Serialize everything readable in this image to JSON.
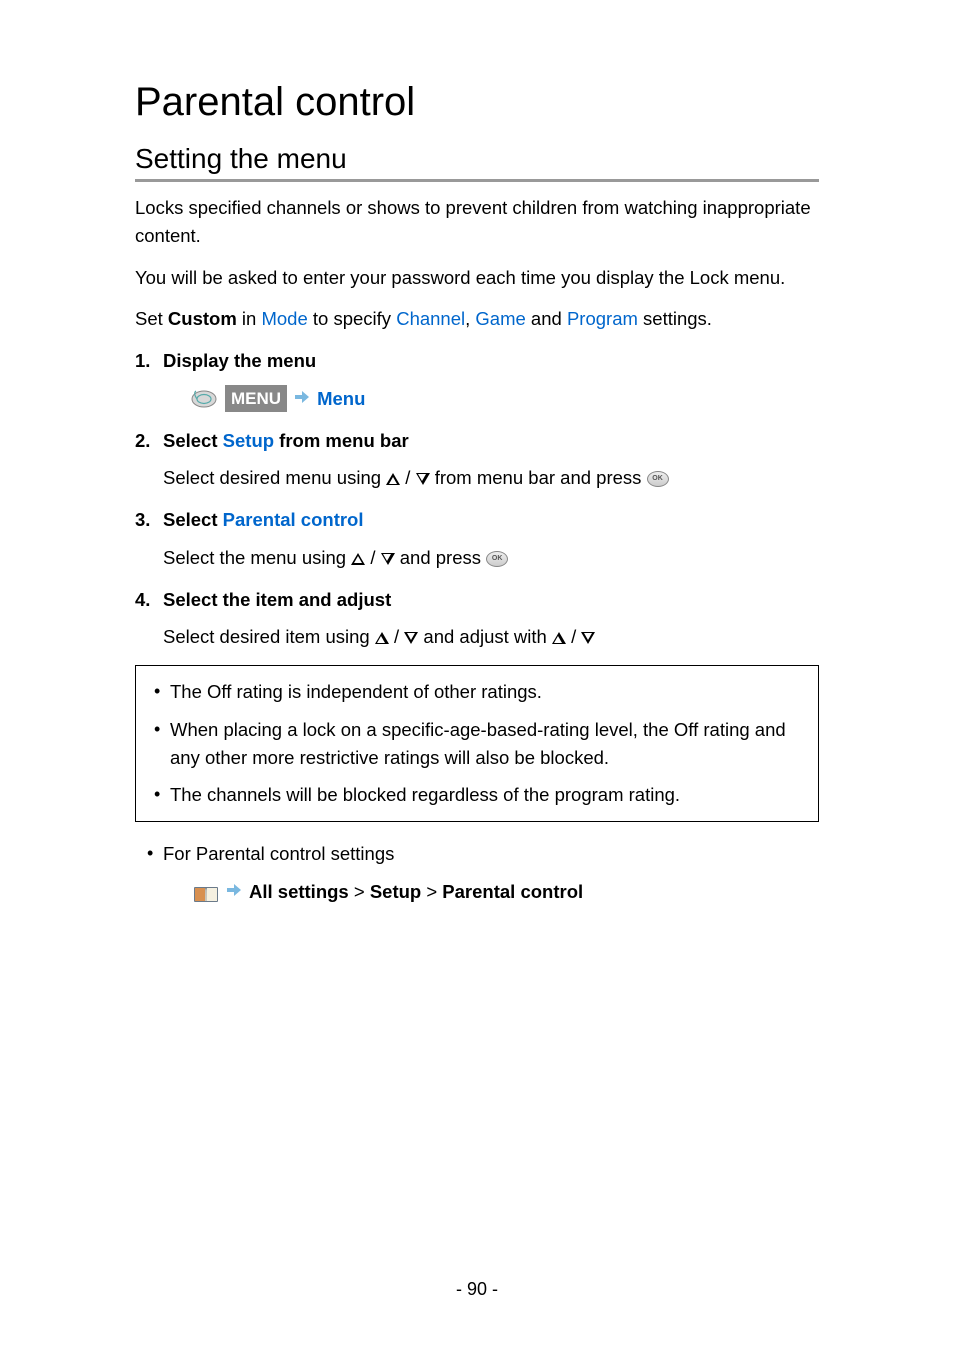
{
  "title": "Parental control",
  "subtitle": "Setting the menu",
  "intro1": "Locks specified channels or shows to prevent children from watching inappropriate content.",
  "intro2": "You will be asked to enter your password each time you display the Lock menu.",
  "setLine": {
    "pre": "Set ",
    "custom": "Custom",
    "in": " in ",
    "mode": "Mode",
    "toSpecify": " to specify ",
    "channel": "Channel",
    "sep1": ", ",
    "game": "Game",
    "and": " and ",
    "program": "Program",
    "post": " settings."
  },
  "steps": [
    {
      "title": "Display the menu",
      "menuBadge": "MENU",
      "menuLabel": "Menu"
    },
    {
      "titlePre": "Select ",
      "titleLink": "Setup",
      "titlePost": " from menu bar",
      "bodyPre": "Select desired menu using ",
      "bodyMid": " / ",
      "bodyPost": " from menu bar and press "
    },
    {
      "titlePre": "Select ",
      "titleLink": "Parental control",
      "bodyPre": "Select the menu using ",
      "bodyMid": " / ",
      "bodyPost": " and press "
    },
    {
      "title": "Select the item and adjust",
      "bodyPre": "Select desired item using ",
      "bodyMid": " / ",
      "bodyMid2": " and adjust with ",
      "bodyMid3": " / "
    }
  ],
  "notes": [
    "The Off rating is independent of other ratings.",
    "When placing a lock on a specific-age-based-rating level, the Off rating and any other more restrictive ratings will also be blocked.",
    "The channels will be blocked regardless of the program rating."
  ],
  "outerNote": "For Parental control settings",
  "related": {
    "all": "All settings",
    "sep": " > ",
    "setup": "Setup",
    "pc": "Parental control"
  },
  "pageNumber": "- 90 -"
}
